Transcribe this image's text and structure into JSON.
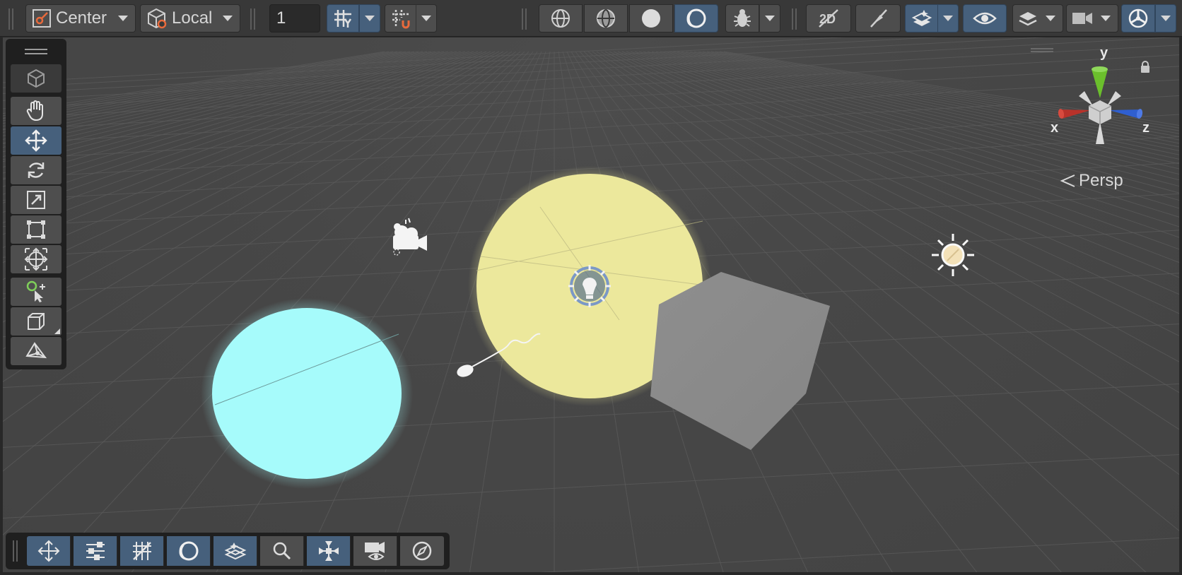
{
  "toolbar": {
    "pivot_mode": "Center",
    "pivot_rotation": "Local",
    "grid_size": "1",
    "icons": [
      "pivot-mode-icon",
      "pivot-rotation-icon",
      "grid-visibility-icon",
      "grid-snapping-icon",
      "wireframe-icon",
      "shaded-wireframe-icon",
      "shaded-icon",
      "unlit-icon",
      "debug-draw-mode-icon",
      "toggle-2d-icon",
      "toggle-lighting-icon",
      "toggle-scene-fx-icon",
      "scene-visibility-icon",
      "layers-icon",
      "camera-settings-icon",
      "gizmos-icon"
    ]
  },
  "tools": {
    "items": [
      "view-tool",
      "move-tool",
      "rotate-tool",
      "scale-tool",
      "rect-tool",
      "transform-tool",
      "custom-tool",
      "create-box-tool",
      "edit-mesh-tool"
    ],
    "active": "move-tool"
  },
  "overlays": {
    "items": [
      "tools-overlay",
      "tool-settings-overlay",
      "grid-and-snap-overlay",
      "draw-modes-overlay",
      "view-options-overlay",
      "search-overlay",
      "orientation-overlay",
      "cameras-overlay",
      "navigation-overlay"
    ]
  },
  "gizmo": {
    "x_label": "x",
    "y_label": "y",
    "z_label": "z",
    "projection": "Persp"
  },
  "colors": {
    "active_button": "#46607c",
    "sphere_yellow": "#ece89c",
    "sphere_cyan": "#a6fbfb",
    "cube": "#8c8c8c",
    "axis_x": "#b8322a",
    "axis_y": "#6bbf2c",
    "axis_z": "#2f5fd0"
  }
}
